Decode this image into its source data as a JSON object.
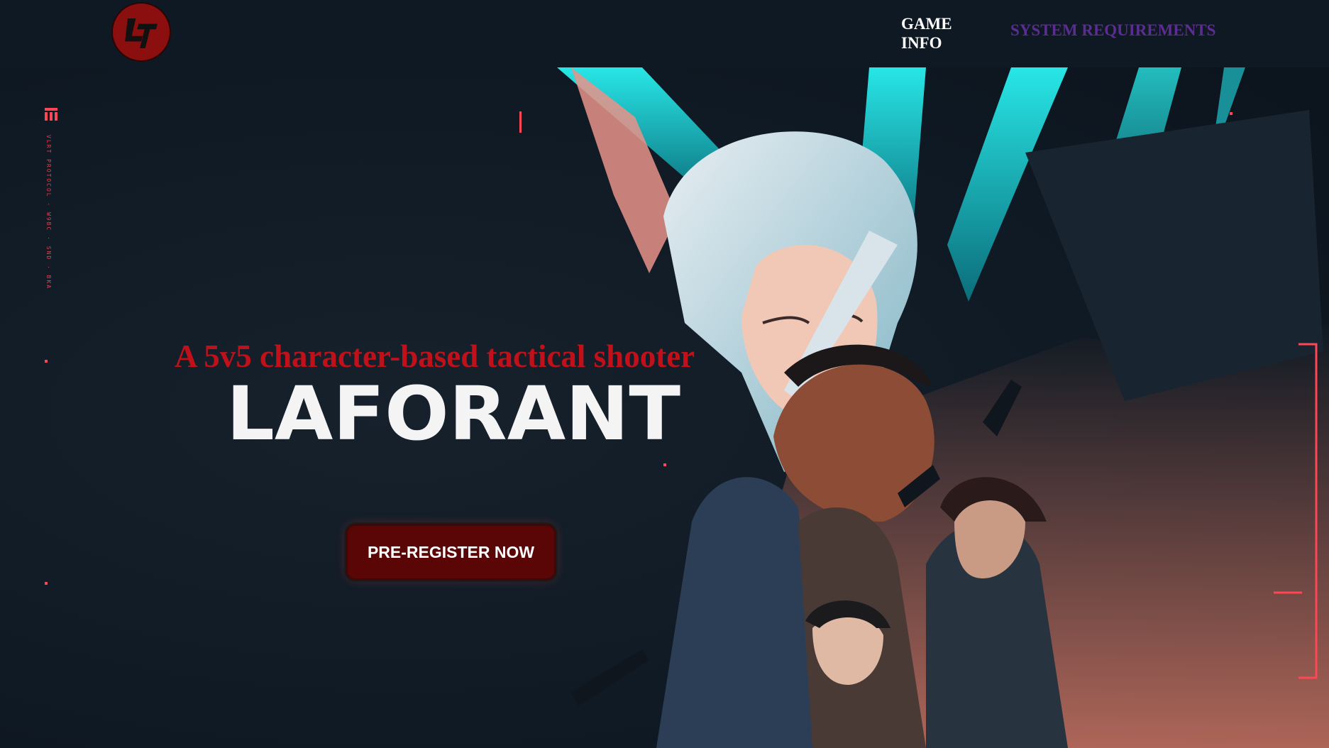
{
  "nav": {
    "logo_alt": "LT",
    "game_info": "GAME INFO",
    "system_requirements": "SYSTEM REQUIREMENTS"
  },
  "hero": {
    "tagline": "A 5v5 character-based tactical shooter",
    "brand_title": "LAFORANT",
    "cta_label": "PRE-REGISTER NOW",
    "side_text": "VLRT PROTOCOL · W9BC · SND · BKA"
  },
  "colors": {
    "background": "#0f1923",
    "accent_red": "#ff4655",
    "tagline_red": "#c0101a",
    "nav_link_visited": "#5b2d91",
    "cta_bg": "#5a0606"
  },
  "icons": {
    "logo": "lt-logo-icon"
  }
}
